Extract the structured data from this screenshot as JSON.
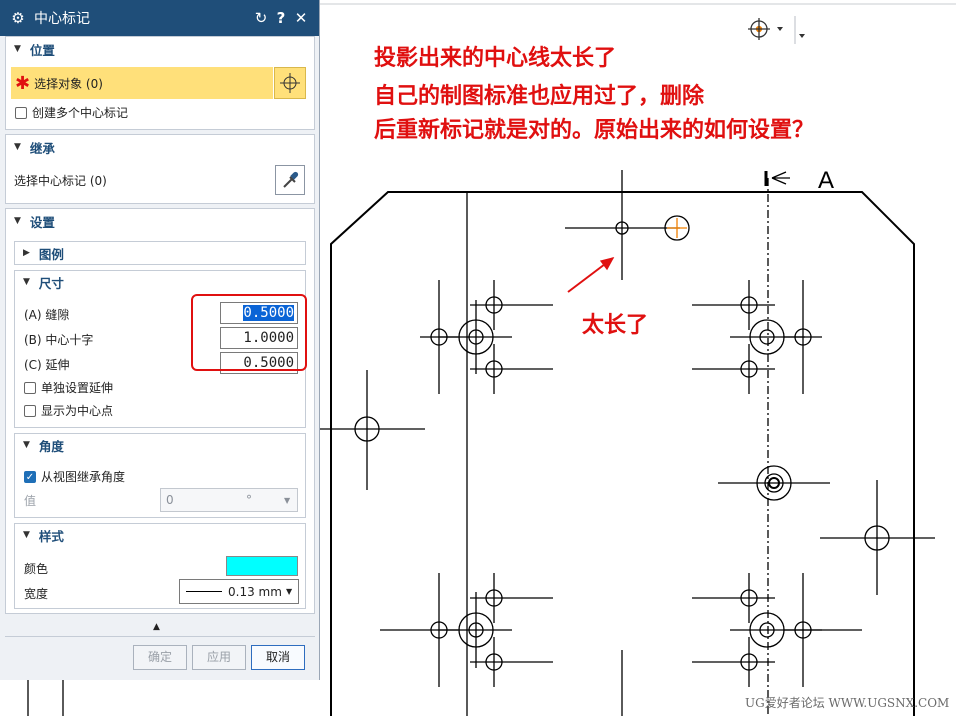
{
  "dialog": {
    "title": "中心标记",
    "sections": {
      "position": {
        "header": "位置",
        "select_object": "选择对象 (0)",
        "create_multiple": "创建多个中心标记"
      },
      "inherit": {
        "header": "继承",
        "select_center_mark": "选择中心标记 (0)"
      },
      "settings": {
        "header": "设置",
        "legend": "图例",
        "size": {
          "header": "尺寸",
          "gap_label": "(A) 缝隙",
          "gap_value": "0.5000",
          "cross_label": "(B) 中心十字",
          "cross_value": "1.0000",
          "extension_label": "(C) 延伸",
          "extension_value": "0.5000",
          "individual_extension": "单独设置延伸",
          "show_as_centerpoint": "显示为中心点"
        },
        "angle": {
          "header": "角度",
          "inherit_from_view": "从视图继承角度",
          "value_label": "值",
          "value": "0",
          "unit": "°"
        },
        "style": {
          "header": "样式",
          "color_label": "颜色",
          "color": "#00ffff",
          "width_label": "宽度",
          "width_value": "0.13 mm"
        }
      }
    },
    "buttons": {
      "ok": "确定",
      "apply": "应用",
      "cancel": "取消"
    }
  },
  "icons": {
    "settings": "gear-icon",
    "reset": "reset-icon",
    "help": "help-icon",
    "close": "close-icon",
    "crosshair": "crosshair-icon",
    "eyedropper": "eyedropper-icon",
    "required": "asterisk-icon"
  },
  "annotations": {
    "line1": "投影出来的中心线太长了",
    "line2": "自己的制图标准也应用过了，删除",
    "line3": "后重新标记就是对的。原始出来的如何设置？",
    "too_long": "太长了",
    "color": "#e01010"
  },
  "drawing": {
    "section_label": "A"
  },
  "watermark": "UG爱好者论坛 WWW.UGSNX.COM"
}
